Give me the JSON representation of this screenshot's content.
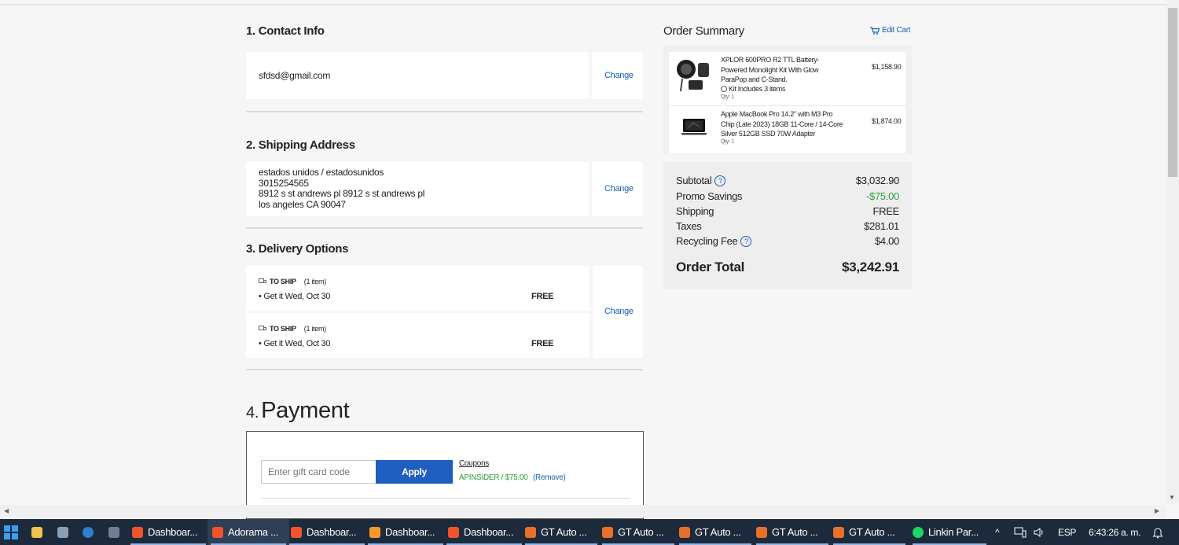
{
  "contact": {
    "title": "1. Contact Info",
    "email": "sfdsd@gmail.com",
    "change_label": "Change"
  },
  "shipping": {
    "title": "2. Shipping Address",
    "lines": [
      "estados unidos / estadosunidos",
      "3015254565",
      "8912 s st andrews pl 8912 s st andrews pl",
      "los angeles CA 90047"
    ],
    "change_label": "Change"
  },
  "delivery": {
    "title": "3. Delivery Options",
    "options": [
      {
        "tag": "TO SHIP",
        "count": "(1 item)",
        "date": "Get it Wed, Oct 30",
        "price": "FREE"
      },
      {
        "tag": "TO SHIP",
        "count": "(1 item)",
        "date": "Get it Wed, Oct 30",
        "price": "FREE"
      }
    ],
    "change_label": "Change"
  },
  "payment": {
    "number": "4.",
    "title": "Payment",
    "gift_placeholder": "Enter gift card code",
    "apply_label": "Apply",
    "coupons_label": "Coupons",
    "coupon_applied": "APINSIDER / $75.00",
    "remove_label": "(Remove)"
  },
  "summary": {
    "title": "Order Summary",
    "edit_cart": "Edit Cart",
    "items": [
      {
        "name": "XPLOR 600PRO R2 TTL Battery-Powered Monolight Kit With Glow ParaPop and C-Stand.",
        "kit": "Kit Includes 3 items",
        "qty": "Qty: 1",
        "price": "$1,158.90"
      },
      {
        "name": "Apple MacBook Pro 14.2\" with M3 Pro Chip (Late 2023) 18GB 11-Core / 14-Core Silver 512GB SSD 70W Adapter",
        "qty": "Qty: 1",
        "price": "$1,874.00"
      }
    ],
    "subtotal_label": "Subtotal",
    "subtotal": "$3,032.90",
    "promo_label": "Promo Savings",
    "promo": "-$75.00",
    "shipping_label": "Shipping",
    "shipping": "FREE",
    "taxes_label": "Taxes",
    "taxes": "$281.01",
    "recycling_label": "Recycling Fee",
    "recycling": "$4.00",
    "total_label": "Order Total",
    "total": "$3,242.91",
    "promo_color": "#2e9e3a"
  },
  "taskbar": {
    "items": [
      "Dashboar...",
      "Adorama ...",
      "Dashboar...",
      "Dashboar...",
      "Dashboar...",
      "GT Auto ...",
      "GT Auto ...",
      "GT Auto ...",
      "GT Auto ...",
      "GT Auto ...",
      "Linkin Par..."
    ],
    "language": "ESP",
    "clock": "6:43:26 a. m."
  }
}
